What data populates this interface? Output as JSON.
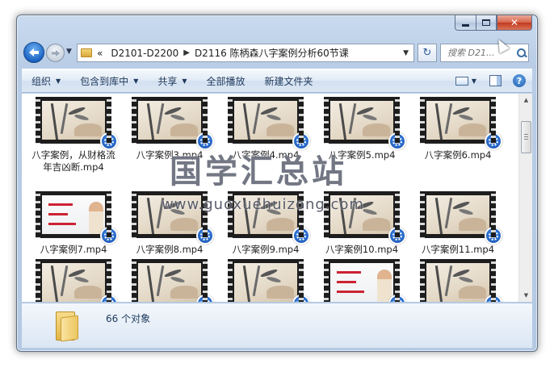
{
  "window": {
    "caption_close": "✕"
  },
  "nav": {
    "overflow": "«",
    "crumbs": [
      "D2101-D2200",
      "D2116 陈柄森八字案例分析60节课"
    ],
    "search_placeholder": "搜索 D21..."
  },
  "toolbar": {
    "organize": "组织",
    "include_library": "包含到库中",
    "share": "共享",
    "play_all": "全部播放",
    "new_folder": "新建文件夹",
    "help": "?"
  },
  "files": [
    {
      "name": "八字案例，从财格流年吉凶断.mp4",
      "thumb": "ink"
    },
    {
      "name": "八字案例3.mp4",
      "thumb": "ink"
    },
    {
      "name": "八字案例4.mp4",
      "thumb": "ink"
    },
    {
      "name": "八字案例5.mp4",
      "thumb": "ink"
    },
    {
      "name": "八字案例6.mp4",
      "thumb": "ink"
    },
    {
      "name": "八字案例7.mp4",
      "thumb": "board"
    },
    {
      "name": "八字案例8.mp4",
      "thumb": "ink"
    },
    {
      "name": "八字案例9.mp4",
      "thumb": "ink"
    },
    {
      "name": "八字案例10.mp4",
      "thumb": "ink"
    },
    {
      "name": "八字案例11.mp4",
      "thumb": "ink"
    },
    {
      "name": "",
      "thumb": "ink"
    },
    {
      "name": "",
      "thumb": "ink"
    },
    {
      "name": "",
      "thumb": "ink"
    },
    {
      "name": "",
      "thumb": "board"
    },
    {
      "name": "",
      "thumb": "ink"
    }
  ],
  "watermark": {
    "title": "国学汇总站",
    "url": "www.guoxuehuizong.com"
  },
  "details": {
    "count": "66 个对象"
  },
  "colors": {
    "frame": "#b9cde6",
    "badge": "#1a4ea8",
    "close": "#c03a1f"
  }
}
